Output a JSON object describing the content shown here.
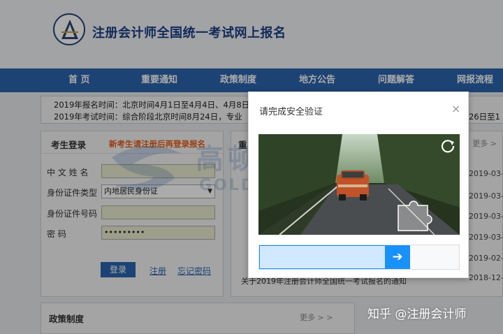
{
  "header": {
    "title": "注册会计师全国统一考试网上报名"
  },
  "nav": {
    "items": [
      "首 页",
      "重要通知",
      "政策制度",
      "地方公告",
      "问题解答",
      "网报流程"
    ]
  },
  "notice": {
    "line1": "2019年报名时间：北京时间4月1日至4月4日、4月8日",
    "line2": "2019年考试时间：综合阶段北京时间8月24日，专业",
    "line2_tail": "26日至1"
  },
  "login": {
    "tab": "考生登录",
    "hint": "新考生请注册后再登录报名",
    "labels": {
      "name": "中 文  姓 名",
      "id_type": "身份证件类型",
      "id_number": "身份证件号码",
      "password": "密          码"
    },
    "id_type_value": "内地居民身份证",
    "password_mask": "•••••••••",
    "login_button": "登录",
    "register_link": "注册",
    "forgot_link": "忘记密码"
  },
  "news": {
    "title": "重",
    "more": "更多 >",
    "dates": [
      "2019-03-",
      "2019-03-",
      "2019-03-",
      "2019-03-",
      "2019-02-",
      "2018-12-"
    ],
    "last_item": "关于2019年注册会计师全国统一考试报名的通知"
  },
  "policy": {
    "title": "政策制度",
    "more": "更多 > >"
  },
  "watermark": {
    "cn": "高顿财经",
    "en": "GOLDEN"
  },
  "captcha": {
    "title": "请完成安全验证",
    "close": "×",
    "handle_arrow": "➔",
    "progress": 0.72
  },
  "brand": {
    "text": "知乎 @注册会计师"
  }
}
